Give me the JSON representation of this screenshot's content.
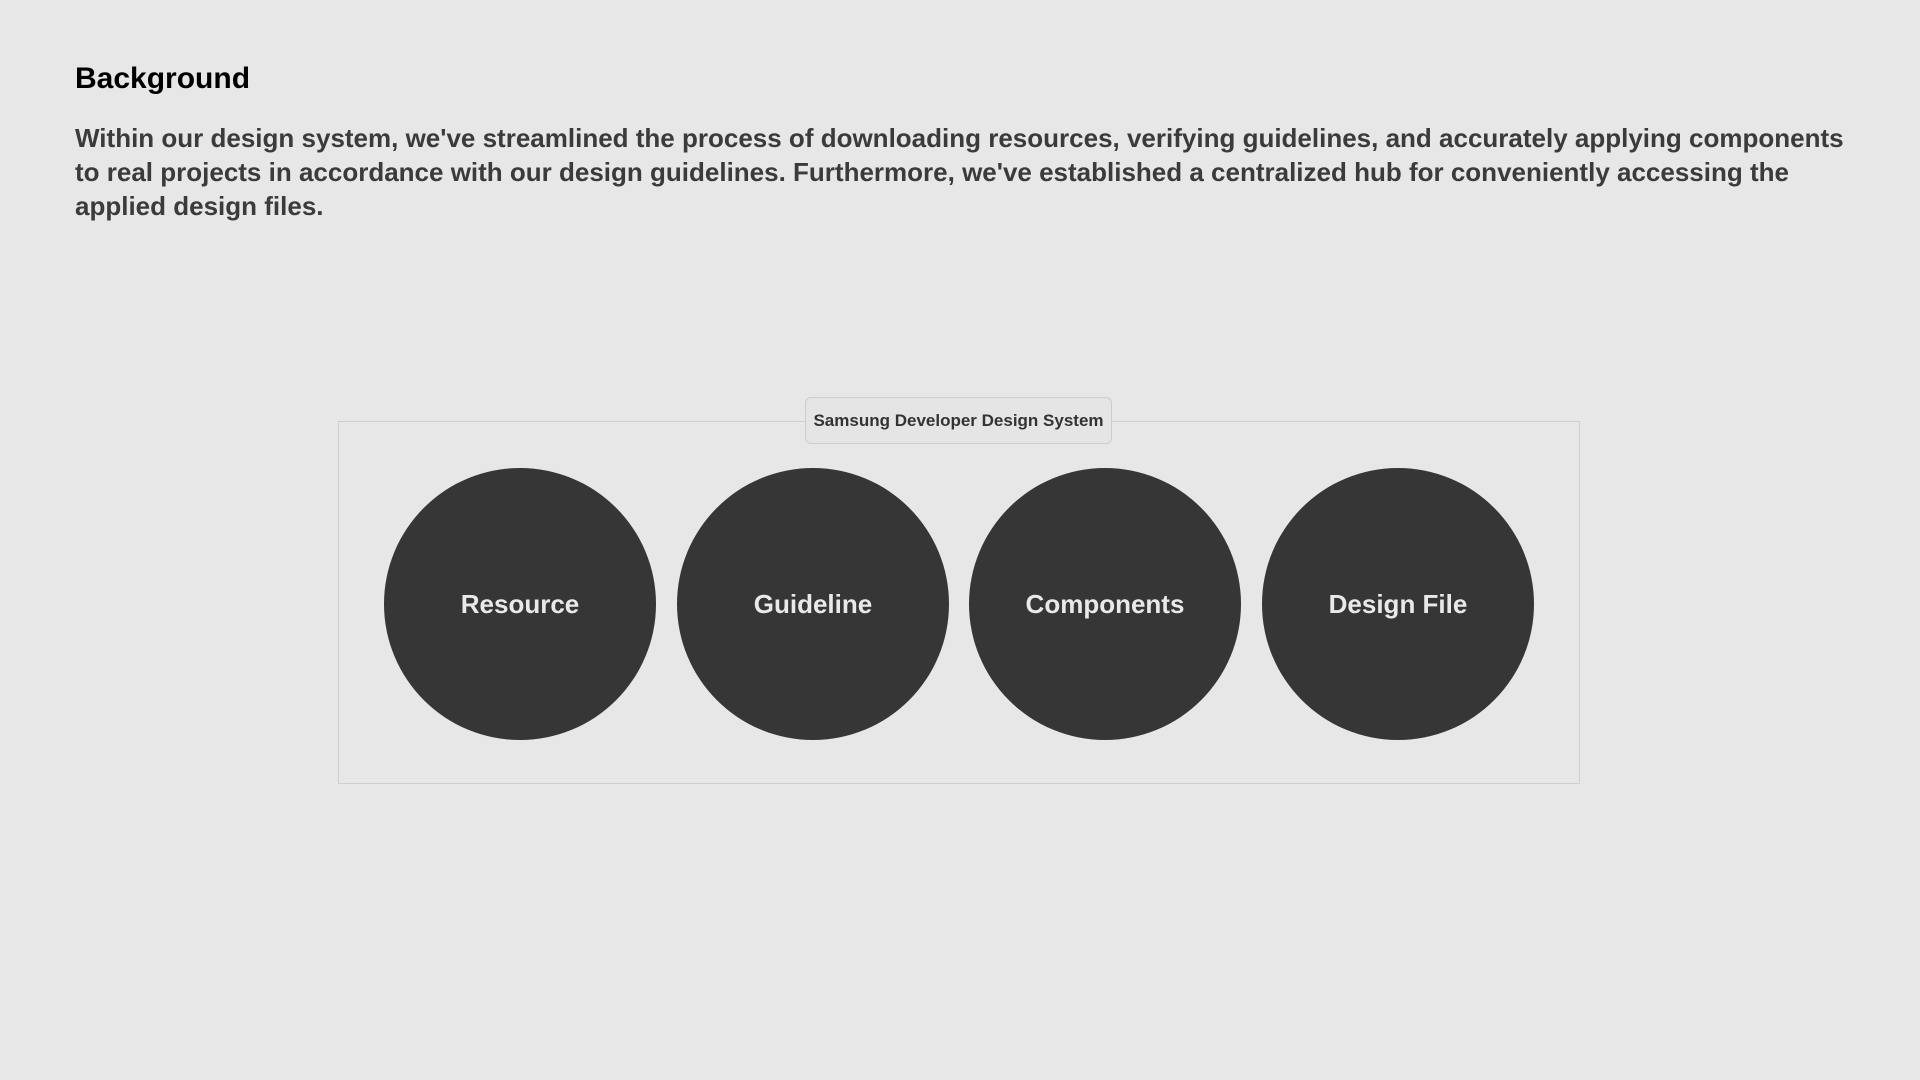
{
  "section": {
    "title": "Background",
    "description": "Within our design system, we've streamlined the process of downloading resources, verifying guidelines, and accurately applying components to real projects in accordance with our design guidelines. Furthermore, we've established a centralized hub for conveniently accessing the applied design files."
  },
  "diagram": {
    "group_label": "Samsung Developer Design System",
    "nodes": [
      {
        "label": "Resource"
      },
      {
        "label": "Guideline"
      },
      {
        "label": "Components"
      },
      {
        "label": "Design File"
      }
    ]
  },
  "colors": {
    "background": "#e7e7e7",
    "node_fill": "#363636",
    "node_text": "#e9e9e9",
    "frame_border": "#cfcfcf"
  }
}
